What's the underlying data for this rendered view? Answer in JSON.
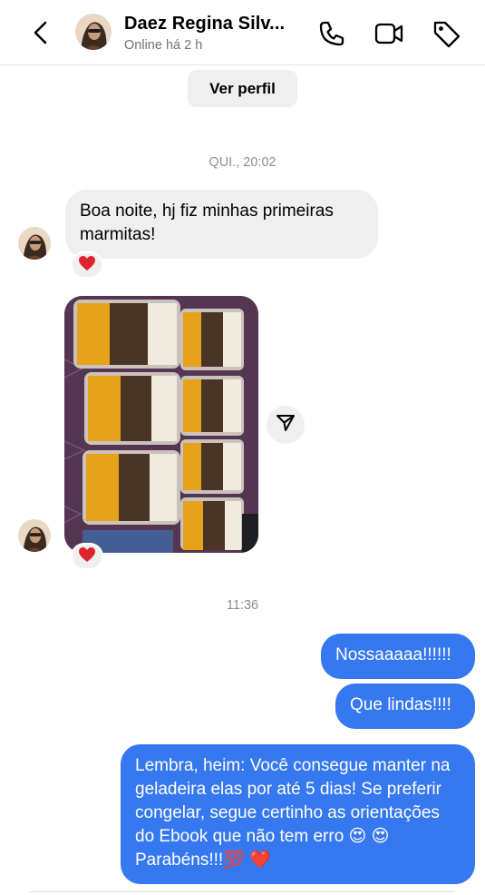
{
  "header": {
    "name": "Daez Regina Silv...",
    "status": "Online há 2 h",
    "icons": [
      "back-chevron-icon",
      "phone-icon",
      "video-call-icon",
      "tag-icon"
    ]
  },
  "profile_button": "Ver perfil",
  "timestamps": {
    "first": "QUI., 20:02",
    "second": "11:36"
  },
  "messages": {
    "incoming_1": "Boa noite, hj fiz minhas primeiras marmitas!",
    "outgoing_1": "Nossaaaaa!!!!!!",
    "outgoing_2": "Que lindas!!!!",
    "outgoing_3": "Lembra, heim: Você consegue manter na geladeira elas por até 5 dias! Se preferir congelar, segue certinho as orientações do Ebook que não tem erro 😍 😍 Parabéns!!!💯 ❤️"
  },
  "reactions": {
    "on_message": "❤️",
    "on_photo": "❤️"
  },
  "colors": {
    "outgoing_bubble": "#3678f0",
    "incoming_bubble": "#efefef",
    "muted_text": "#8e8e8e",
    "heart": "#e0242f"
  }
}
